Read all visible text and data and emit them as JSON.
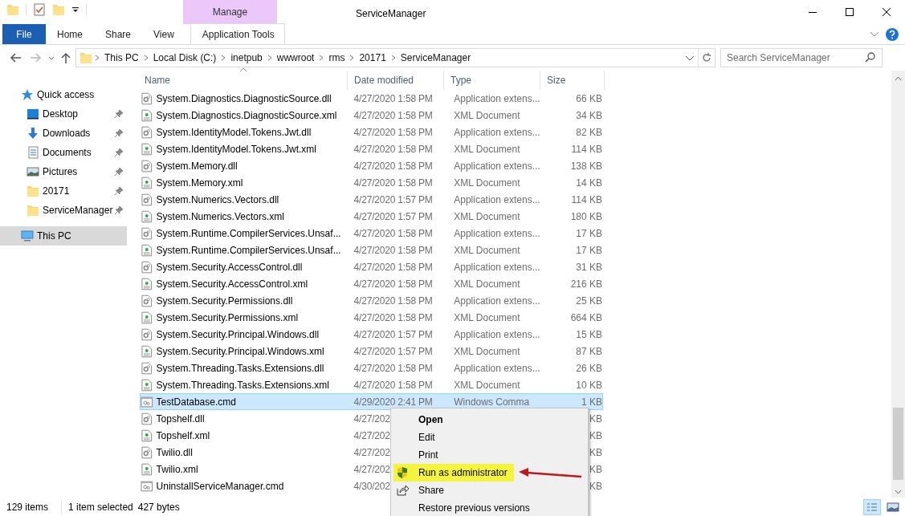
{
  "window": {
    "title": "ServiceManager"
  },
  "context_tab": {
    "group": "Manage",
    "label": "Application Tools"
  },
  "ribbon_tabs": [
    {
      "label": "File",
      "kind": "file"
    },
    {
      "label": "Home",
      "kind": "tab"
    },
    {
      "label": "Share",
      "kind": "tab"
    },
    {
      "label": "View",
      "kind": "tab"
    }
  ],
  "address": {
    "path": [
      "This PC",
      "Local Disk (C:)",
      "inetpub",
      "wwwroot",
      "rms",
      "20171",
      "ServiceManager"
    ]
  },
  "search": {
    "placeholder": "Search ServiceManager"
  },
  "sidebar": {
    "items": [
      {
        "label": "Quick access",
        "kind": "star",
        "pinned": false,
        "selected": false,
        "sub": false
      },
      {
        "label": "Desktop",
        "kind": "desktop",
        "pinned": true,
        "selected": false,
        "sub": true
      },
      {
        "label": "Downloads",
        "kind": "download",
        "pinned": true,
        "selected": false,
        "sub": true
      },
      {
        "label": "Documents",
        "kind": "documents",
        "pinned": true,
        "selected": false,
        "sub": true
      },
      {
        "label": "Pictures",
        "kind": "pictures",
        "pinned": true,
        "selected": false,
        "sub": true
      },
      {
        "label": "20171",
        "kind": "folder",
        "pinned": true,
        "selected": false,
        "sub": true
      },
      {
        "label": "ServiceManager",
        "kind": "folder",
        "pinned": true,
        "selected": false,
        "sub": true
      },
      {
        "label": "This PC",
        "kind": "pc",
        "pinned": false,
        "selected": true,
        "sub": false
      }
    ]
  },
  "table": {
    "columns": [
      "Name",
      "Date modified",
      "Type",
      "Size"
    ],
    "rows": [
      {
        "kind": "dll",
        "name": "System.Diagnostics.DiagnosticSource.dll",
        "date": "4/27/2020 1:58 PM",
        "type": "Application extens...",
        "size": "66 KB",
        "selected": false
      },
      {
        "kind": "xml",
        "name": "System.Diagnostics.DiagnosticSource.xml",
        "date": "4/27/2020 1:58 PM",
        "type": "XML Document",
        "size": "34 KB",
        "selected": false
      },
      {
        "kind": "dll",
        "name": "System.IdentityModel.Tokens.Jwt.dll",
        "date": "4/27/2020 1:58 PM",
        "type": "Application extens...",
        "size": "82 KB",
        "selected": false
      },
      {
        "kind": "xml",
        "name": "System.IdentityModel.Tokens.Jwt.xml",
        "date": "4/27/2020 1:58 PM",
        "type": "XML Document",
        "size": "114 KB",
        "selected": false
      },
      {
        "kind": "dll",
        "name": "System.Memory.dll",
        "date": "4/27/2020 1:58 PM",
        "type": "Application extens...",
        "size": "138 KB",
        "selected": false
      },
      {
        "kind": "xml",
        "name": "System.Memory.xml",
        "date": "4/27/2020 1:58 PM",
        "type": "XML Document",
        "size": "14 KB",
        "selected": false
      },
      {
        "kind": "dll",
        "name": "System.Numerics.Vectors.dll",
        "date": "4/27/2020 1:57 PM",
        "type": "Application extens...",
        "size": "114 KB",
        "selected": false
      },
      {
        "kind": "xml",
        "name": "System.Numerics.Vectors.xml",
        "date": "4/27/2020 1:57 PM",
        "type": "XML Document",
        "size": "180 KB",
        "selected": false
      },
      {
        "kind": "dll",
        "name": "System.Runtime.CompilerServices.Unsaf...",
        "date": "4/27/2020 1:58 PM",
        "type": "Application extens...",
        "size": "17 KB",
        "selected": false
      },
      {
        "kind": "xml",
        "name": "System.Runtime.CompilerServices.Unsaf...",
        "date": "4/27/2020 1:58 PM",
        "type": "XML Document",
        "size": "17 KB",
        "selected": false
      },
      {
        "kind": "dll",
        "name": "System.Security.AccessControl.dll",
        "date": "4/27/2020 1:58 PM",
        "type": "Application extens...",
        "size": "31 KB",
        "selected": false
      },
      {
        "kind": "xml",
        "name": "System.Security.AccessControl.xml",
        "date": "4/27/2020 1:58 PM",
        "type": "XML Document",
        "size": "216 KB",
        "selected": false
      },
      {
        "kind": "dll",
        "name": "System.Security.Permissions.dll",
        "date": "4/27/2020 1:58 PM",
        "type": "Application extens...",
        "size": "25 KB",
        "selected": false
      },
      {
        "kind": "xml",
        "name": "System.Security.Permissions.xml",
        "date": "4/27/2020 1:58 PM",
        "type": "XML Document",
        "size": "664 KB",
        "selected": false
      },
      {
        "kind": "dll",
        "name": "System.Security.Principal.Windows.dll",
        "date": "4/27/2020 1:57 PM",
        "type": "Application extens...",
        "size": "15 KB",
        "selected": false
      },
      {
        "kind": "xml",
        "name": "System.Security.Principal.Windows.xml",
        "date": "4/27/2020 1:57 PM",
        "type": "XML Document",
        "size": "87 KB",
        "selected": false
      },
      {
        "kind": "dll",
        "name": "System.Threading.Tasks.Extensions.dll",
        "date": "4/27/2020 1:58 PM",
        "type": "Application extens...",
        "size": "26 KB",
        "selected": false
      },
      {
        "kind": "xml",
        "name": "System.Threading.Tasks.Extensions.xml",
        "date": "4/27/2020 1:58 PM",
        "type": "XML Document",
        "size": "10 KB",
        "selected": false
      },
      {
        "kind": "cmd",
        "name": "TestDatabase.cmd",
        "date": "4/29/2020 2:41 PM",
        "type": "Windows Comma",
        "size": "1 KB",
        "selected": true
      },
      {
        "kind": "dll",
        "name": "Topshelf.dll",
        "date": "4/27/202",
        "size": "KB",
        "selected": false
      },
      {
        "kind": "xml",
        "name": "Topshelf.xml",
        "date": "4/27/202",
        "size": "KB",
        "selected": false
      },
      {
        "kind": "dll",
        "name": "Twilio.dll",
        "date": "4/27/202",
        "size": "KB",
        "selected": false
      },
      {
        "kind": "xml",
        "name": "Twilio.xml",
        "date": "4/27/202",
        "size": "KB",
        "selected": false
      },
      {
        "kind": "cmd",
        "name": "UninstallServiceManager.cmd",
        "date": "4/30/202",
        "size": "KB",
        "selected": false
      }
    ]
  },
  "context_menu": {
    "items": [
      {
        "label": "Open",
        "kind": "default",
        "highlighted": false
      },
      {
        "label": "Edit",
        "kind": "plain",
        "highlighted": false
      },
      {
        "label": "Print",
        "kind": "plain",
        "highlighted": false
      },
      {
        "label": "Run as administrator",
        "kind": "shield",
        "highlighted": true
      },
      {
        "label": "Share",
        "kind": "share",
        "highlighted": false
      },
      {
        "label": "Restore previous versions",
        "kind": "plain",
        "highlighted": false
      }
    ]
  },
  "status_bar": {
    "count": "129 items",
    "selection": "1 item selected",
    "size": "427 bytes",
    "views": [
      {
        "kind": "details",
        "selected": true
      },
      {
        "kind": "icons",
        "selected": false
      }
    ]
  }
}
